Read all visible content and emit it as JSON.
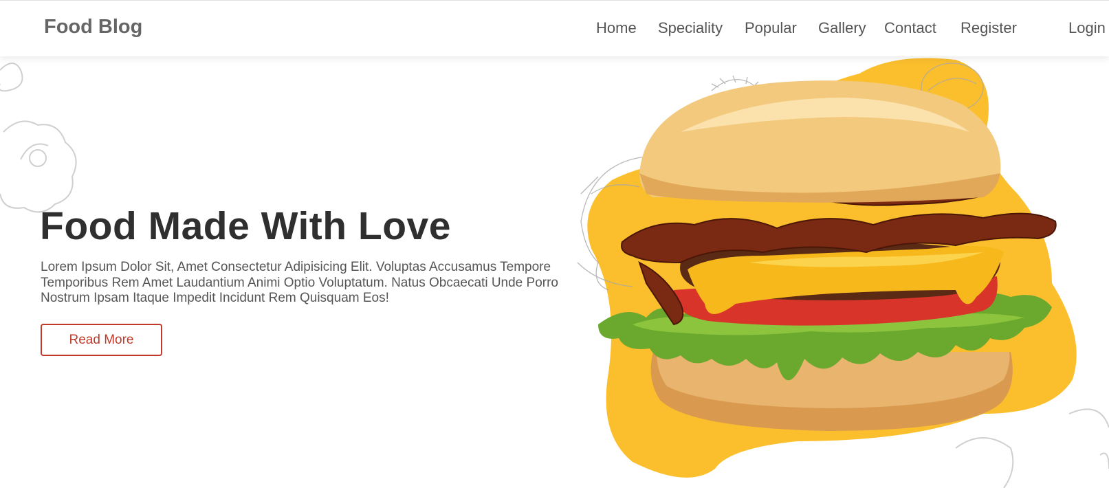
{
  "header": {
    "brand": "Food Blog",
    "nav": [
      {
        "label": "Home"
      },
      {
        "label": "Speciality"
      },
      {
        "label": "Popular"
      },
      {
        "label": "Gallery"
      },
      {
        "label": "Contact"
      },
      {
        "label": "Register"
      },
      {
        "label": "Login"
      }
    ]
  },
  "hero": {
    "title": "Food Made With Love",
    "description": "Lorem Ipsum Dolor Sit, Amet Consectetur Adipisicing Elit. Voluptas Accusamus Tempore Temporibus Rem Amet Laudantium Animi Optio Voluptatum. Natus Obcaecati Unde Porro Nostrum Ipsam Itaque Impedit Incidunt Rem Quisquam Eos!",
    "button_label": "Read More",
    "image": "burger-with-bacon-cheese-tomato-lettuce"
  },
  "colors": {
    "accent": "#c0392b",
    "blob": "#fbbf2e",
    "title": "#2f2f2f",
    "text": "#555555"
  }
}
